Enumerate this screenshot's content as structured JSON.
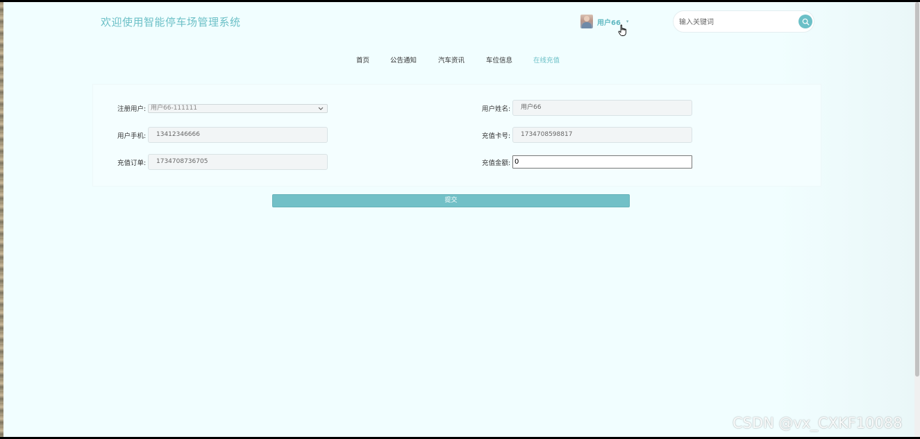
{
  "header": {
    "site_title": "欢迎使用智能停车场管理系统",
    "user": {
      "name": "用户66",
      "avatar_icon": "user-avatar",
      "caret_icon": "caret-down-icon"
    },
    "search": {
      "placeholder": "输入关键词",
      "button_icon": "search-icon"
    }
  },
  "nav": {
    "items": [
      {
        "label": "首页",
        "active": false
      },
      {
        "label": "公告通知",
        "active": false
      },
      {
        "label": "汽车资讯",
        "active": false
      },
      {
        "label": "车位信息",
        "active": false
      },
      {
        "label": "在线充值",
        "active": true
      }
    ]
  },
  "form": {
    "registered_user": {
      "label": "注册用户:",
      "value": "用户66-111111"
    },
    "user_name": {
      "label": "用户姓名:",
      "value": "用户66"
    },
    "user_phone": {
      "label": "用户手机:",
      "value": "13412346666"
    },
    "card_number": {
      "label": "充值卡号:",
      "value": "1734708598817"
    },
    "order_number": {
      "label": "充值订单:",
      "value": "1734708736705"
    },
    "amount": {
      "label": "充值金额:",
      "value": "0"
    },
    "submit_label": "提交"
  },
  "watermark": "CSDN @vx_CXKF10088",
  "colors": {
    "accent": "#6cc0c7",
    "page_background": "#f1feff",
    "button": "#72c0c7"
  }
}
